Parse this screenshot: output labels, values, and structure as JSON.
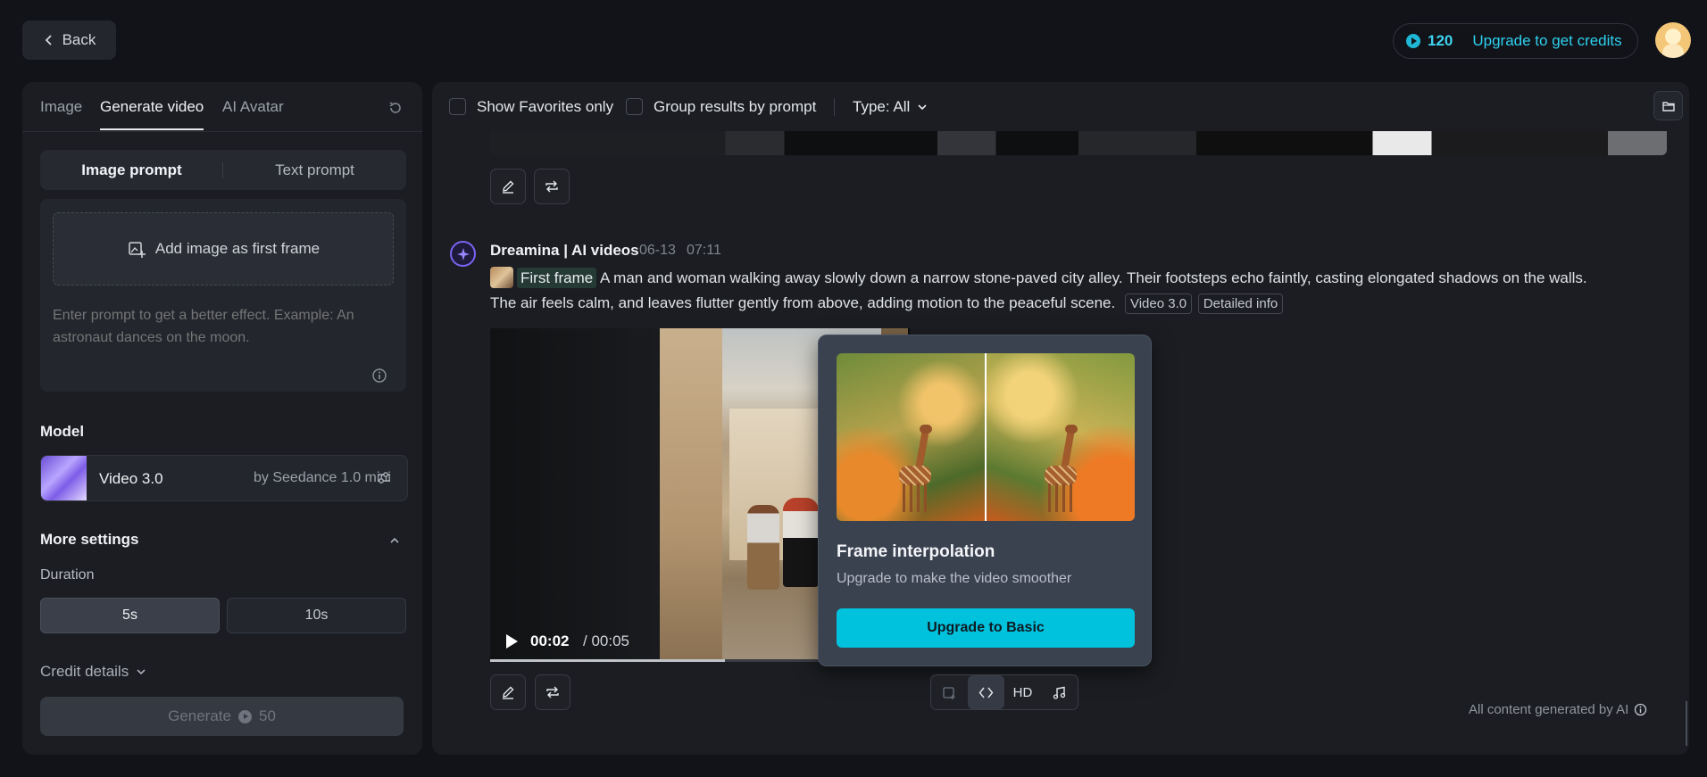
{
  "header": {
    "back_label": "Back",
    "credits": "120",
    "upgrade_label": "Upgrade to get credits"
  },
  "left": {
    "tabs": [
      {
        "label": "Image",
        "active": false
      },
      {
        "label": "Generate video",
        "active": true
      },
      {
        "label": "AI Avatar",
        "active": false
      }
    ],
    "prompt_mode": {
      "image_prompt": "Image prompt",
      "text_prompt": "Text prompt",
      "active": "image_prompt"
    },
    "add_image_label": "Add image as first frame",
    "prompt_placeholder": "Enter prompt to get a better effect. Example: An astronaut dances on the moon.",
    "model_section_label": "Model",
    "model": {
      "name": "Video 3.0",
      "by": "by Seedance 1.0 mini"
    },
    "more_settings_label": "More settings",
    "duration_label": "Duration",
    "durations": [
      {
        "label": "5s",
        "active": true
      },
      {
        "label": "10s",
        "active": false
      }
    ],
    "credit_details_label": "Credit details",
    "generate": {
      "label": "Generate",
      "cost": "50"
    }
  },
  "filters": {
    "favorites_label": "Show Favorites only",
    "group_label": "Group results by prompt",
    "type_label": "Type: All"
  },
  "generation": {
    "title": "Dreamina | AI videos",
    "date": "06-13",
    "time": "07:11",
    "first_frame_label": "First frame",
    "prompt_line1": "A man and woman walking away slowly down a narrow stone-paved city alley. Their footsteps echo faintly, casting elongated shadows on the walls.",
    "prompt_line2": "The air feels calm, and leaves flutter gently from above, adding motion to the peaceful scene.",
    "tags": [
      "Video 3.0",
      "Detailed info"
    ],
    "video": {
      "current_time": "00:02",
      "total_time": "/ 00:05",
      "progress": 0.56
    },
    "toolbar": {
      "hd_label": "HD"
    }
  },
  "popover": {
    "title": "Frame interpolation",
    "subtitle": "Upgrade to make the video smoother",
    "button_label": "Upgrade to Basic"
  },
  "footer_note": "All content generated by AI",
  "colors": {
    "accent": "#00c2dd",
    "credit": "#3fd2ef",
    "background": "#111318",
    "panel": "#1b1d22"
  }
}
